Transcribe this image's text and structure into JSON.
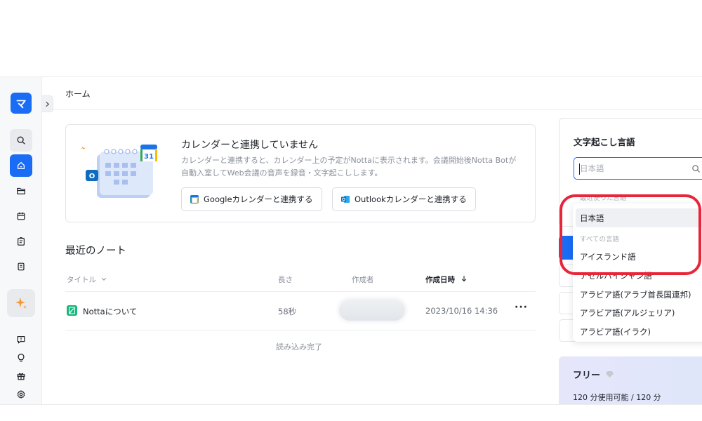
{
  "sidebar": {
    "logo": "マ",
    "items": [
      {
        "name": "search",
        "icon": "search-icon"
      },
      {
        "name": "home",
        "icon": "home-icon"
      },
      {
        "name": "folder",
        "icon": "folder-icon"
      },
      {
        "name": "calendar",
        "icon": "calendar-icon"
      },
      {
        "name": "tasks",
        "icon": "clipboard-icon"
      },
      {
        "name": "document",
        "icon": "document-icon"
      },
      {
        "name": "ai",
        "icon": "sparkle-icon"
      },
      {
        "name": "feedback",
        "icon": "feedback-icon"
      },
      {
        "name": "tips",
        "icon": "lightbulb-icon"
      },
      {
        "name": "gift",
        "icon": "gift-icon"
      },
      {
        "name": "settings",
        "icon": "gear-icon"
      }
    ]
  },
  "header": {
    "title": "ホーム"
  },
  "calendar_card": {
    "title": "カレンダーと連携していません",
    "description": "カレンダーと連携すると、カレンダー上の予定がNottaに表示されます。会議開始後Notta Botが自動入室してWeb会議の音声を録音・文字起こしします。",
    "google_button": "Googleカレンダーと連携する",
    "outlook_button": "Outlookカレンダーと連携する",
    "calendar_day": "31"
  },
  "recent_notes": {
    "title": "最近のノート",
    "columns": {
      "title": "タイトル",
      "length": "長さ",
      "creator": "作成者",
      "created_at": "作成日時"
    },
    "rows": [
      {
        "title": "Nottaについて",
        "length": "58秒",
        "created_at": "2023/10/16 14:36"
      }
    ],
    "footer": "読み込み完了",
    "more": "···"
  },
  "language_panel": {
    "label": "文字起こし言語",
    "search_placeholder": "日本語",
    "recent_label": "最近使った言語",
    "recent_items": [
      "日本語"
    ],
    "all_label": "すべての言語",
    "all_items": [
      "アイスランド語",
      "アゼルバイジャン語",
      "アラビア語(アラブ首長国連邦)",
      "アラビア語(アルジェリア)",
      "アラビア語(イラク)"
    ]
  },
  "plan_card": {
    "title": "フリー",
    "usage": "120 分使用可能 / 120 分"
  },
  "colors": {
    "accent": "#1a6cf5",
    "highlight": "#e8263a",
    "note_icon": "#18b77e"
  }
}
